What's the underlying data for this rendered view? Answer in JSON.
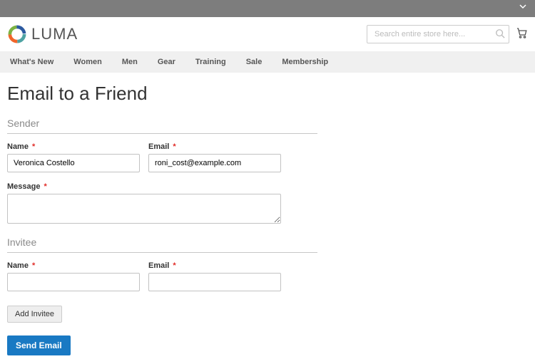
{
  "search": {
    "placeholder": "Search entire store here..."
  },
  "logo": {
    "text": "LUMA"
  },
  "nav": {
    "items": [
      {
        "label": "What's New"
      },
      {
        "label": "Women"
      },
      {
        "label": "Men"
      },
      {
        "label": "Gear"
      },
      {
        "label": "Training"
      },
      {
        "label": "Sale"
      },
      {
        "label": "Membership"
      }
    ]
  },
  "page": {
    "title": "Email to a Friend"
  },
  "sender": {
    "legend": "Sender",
    "name_label": "Name",
    "name_value": "Veronica Costello",
    "email_label": "Email",
    "email_value": "roni_cost@example.com",
    "message_label": "Message",
    "message_value": ""
  },
  "invitee": {
    "legend": "Invitee",
    "name_label": "Name",
    "name_value": "",
    "email_label": "Email",
    "email_value": ""
  },
  "buttons": {
    "add_invitee": "Add Invitee",
    "send_email": "Send Email"
  },
  "required_marker": "*"
}
